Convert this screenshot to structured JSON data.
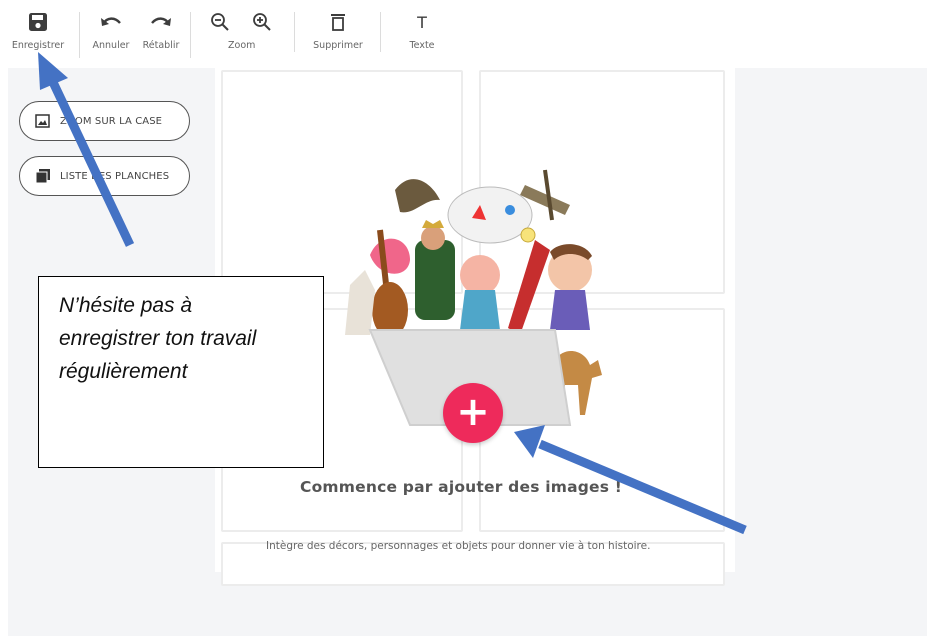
{
  "toolbar": {
    "save_label": "Enregistrer",
    "undo_label": "Annuler",
    "redo_label": "Rétablir",
    "zoom_label": "Zoom",
    "delete_label": "Supprimer",
    "text_label": "Texte",
    "text_glyph": "T"
  },
  "sidebar": {
    "zoom_cell_label": "ZOOM SUR LA CASE",
    "page_list_label": "LISTE DES PLANCHES"
  },
  "empty_state": {
    "title": "Commence par ajouter des images !",
    "subtitle": "Intègre des décors, personnages et objets pour donner vie à ton histoire.",
    "add_glyph": "+"
  },
  "callout": {
    "lines": [
      "N’hésite pas à",
      "enregistrer ton travail",
      "régulièrement"
    ]
  },
  "colors": {
    "accent": "#ee2a5b",
    "arrow": "#4472c4",
    "workspace_bg": "#f4f5f7"
  }
}
